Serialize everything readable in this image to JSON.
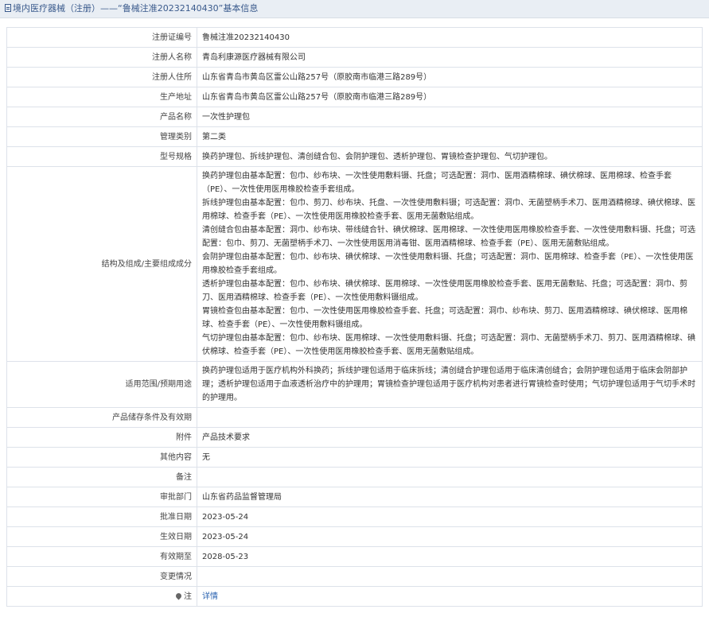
{
  "header": {
    "icon": "document-icon",
    "title": "境内医疗器械（注册）——“鲁械注准20232140430”基本信息"
  },
  "rows": {
    "reg_no": {
      "label": "注册证编号",
      "value": "鲁械注准20232140430"
    },
    "registrant": {
      "label": "注册人名称",
      "value": "青岛利康源医疗器械有限公司"
    },
    "address": {
      "label": "注册人住所",
      "value": "山东省青岛市黄岛区雷公山路257号（原胶南市临港三路289号）"
    },
    "production_address": {
      "label": "生产地址",
      "value": "山东省青岛市黄岛区雷公山路257号（原胶南市临港三路289号）"
    },
    "product_name": {
      "label": "产品名称",
      "value": "一次性护理包"
    },
    "category": {
      "label": "管理类别",
      "value": "第二类"
    },
    "models": {
      "label": "型号规格",
      "value": "换药护理包、拆线护理包、清创缝合包、会阴护理包、透析护理包、胃镜检查护理包、气切护理包。"
    },
    "composition": {
      "label": "结构及组成/主要组成成分",
      "lines": [
        "换药护理包由基本配置：包巾、纱布块、一次性使用敷料镊、托盘；可选配置：洞巾、医用酒精棉球、碘伏棉球、医用棉球、检查手套（PE）、一次性使用医用橡胶检查手套组成。",
        "拆线护理包由基本配置：包巾、剪刀、纱布块、托盘、一次性使用敷料镊；可选配置：洞巾、无菌塑柄手术刀、医用酒精棉球、碘伏棉球、医用棉球、检查手套（PE）、一次性使用医用橡胶检查手套、医用无菌敷贴组成。",
        "清创缝合包由基本配置：洞巾、纱布块、带线缝合针、碘伏棉球、医用棉球、一次性使用医用橡胶检查手套、一次性使用敷料镊、托盘；可选配置：包巾、剪刀、无菌塑柄手术刀、一次性使用医用消毒钳、医用酒精棉球、检查手套（PE）、医用无菌敷贴组成。",
        "会阴护理包由基本配置：包巾、纱布块、碘伏棉球、一次性使用敷料镊、托盘；可选配置：洞巾、医用棉球、检查手套（PE）、一次性使用医用橡胶检查手套组成。",
        "透析护理包由基本配置：包巾、纱布块、碘伏棉球、医用棉球、一次性使用医用橡胶检查手套、医用无菌敷贴、托盘；可选配置：洞巾、剪刀、医用酒精棉球、检查手套（PE）、一次性使用敷料镊组成。",
        "胃镜检查包由基本配置：包巾、一次性使用医用橡胶检查手套、托盘；可选配置：洞巾、纱布块、剪刀、医用酒精棉球、碘伏棉球、医用棉球、检查手套（PE）、一次性使用敷料镊组成。",
        "气切护理包由基本配置：包巾、纱布块、医用棉球、一次性使用敷料镊、托盘；可选配置：洞巾、无菌塑柄手术刀、剪刀、医用酒精棉球、碘伏棉球、检查手套（PE）、一次性使用医用橡胶检查手套、医用无菌敷贴组成。"
      ]
    },
    "scope": {
      "label": "适用范围/预期用途",
      "value": "换药护理包适用于医疗机构外科换药；拆线护理包适用于临床拆线；清创缝合护理包适用于临床清创缝合；会阴护理包适用于临床会阴部护理；透析护理包适用于血液透析治疗中的护理用；胃镜检查护理包适用于医疗机构对患者进行胃镜检查时使用；气切护理包适用于气切手术时的护理用。"
    },
    "storage": {
      "label": "产品储存条件及有效期",
      "value": ""
    },
    "attachment": {
      "label": "附件",
      "value": "产品技术要求"
    },
    "other": {
      "label": "其他内容",
      "value": "无"
    },
    "remark": {
      "label": "备注",
      "value": ""
    },
    "dept": {
      "label": "审批部门",
      "value": "山东省药品监督管理局"
    },
    "approval_date": {
      "label": "批准日期",
      "value": "2023-05-24"
    },
    "effective_date": {
      "label": "生效日期",
      "value": "2023-05-24"
    },
    "expiry_date": {
      "label": "有效期至",
      "value": "2028-05-23"
    },
    "changes": {
      "label": "变更情况",
      "value": ""
    },
    "note": {
      "label": "注",
      "icon": "pin-icon",
      "link": "详情"
    }
  }
}
